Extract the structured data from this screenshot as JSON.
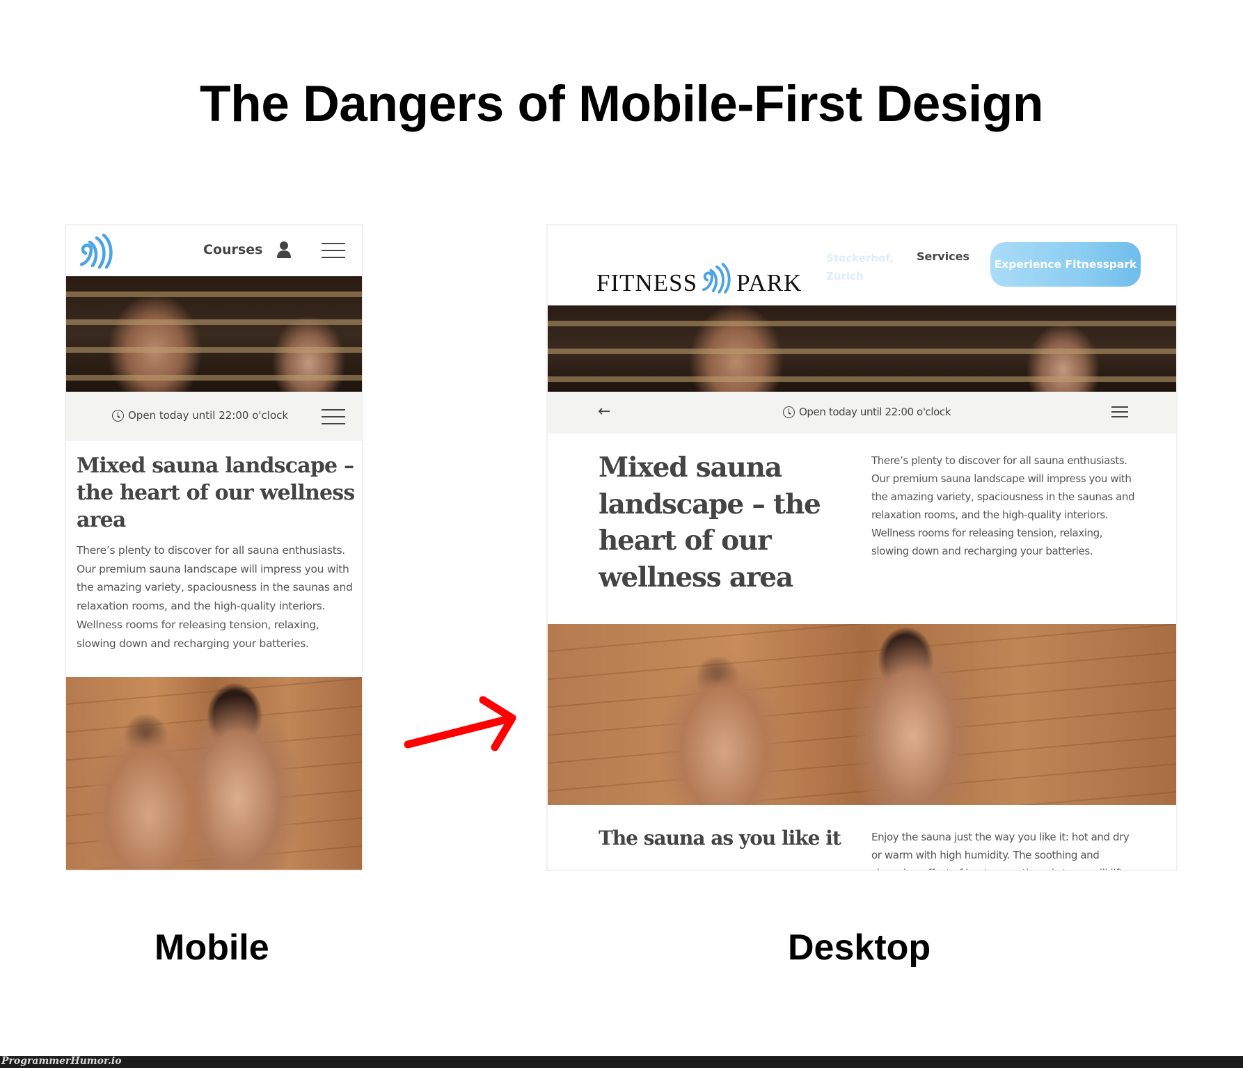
{
  "meme": {
    "title": "The Dangers of Mobile-First Design",
    "caption_mobile": "Mobile",
    "caption_desktop": "Desktop",
    "arrow_color": "#ff0000",
    "watermark": "ProgrammerHumor.io"
  },
  "brand": {
    "accent": "#4aa3e2",
    "cta_gradient": [
      "#aadcf8",
      "#6fbdeb"
    ],
    "text_color": "#444444",
    "infobar_bg": "#f3f3f2"
  },
  "mobile": {
    "logo_icon": "wave-logo-icon",
    "nav_courses": "Courses",
    "user_icon": "user-icon",
    "menu_icon": "hamburger-menu-icon",
    "hero_image": "sauna-hero-photo",
    "open_hours": "Open today until 22:00 o'clock",
    "heading": "Mixed sauna landscape – the heart of our wellness area",
    "body": "There’s plenty to discover for all sauna enthusiasts. Our premium sauna landscape will impress you with the amazing variety, spaciousness in the saunas and relaxation rooms, and the high-quality interiors. Wellness rooms for releasing tension, relaxing, slowing down and recharging your batteries.",
    "second_image": "sauna-couple-photo"
  },
  "desktop": {
    "logo_left": "FITNESS",
    "logo_right": "PARK",
    "location_line1": "Stockerhof,",
    "location_line2": "Zürich",
    "nav_services": "Services",
    "cta_label": "Experience Fitnesspark",
    "back_icon": "←",
    "open_hours": "Open today until 22:00 o'clock",
    "heading": "Mixed sauna landscape – the heart of our wellness area",
    "body": "There’s plenty to discover for all sauna enthusiasts. Our premium sauna landscape will impress you with the amazing variety, spaciousness in the saunas and relaxation rooms, and the high-quality interiors. Wellness rooms for releasing tension, relaxing, slowing down and recharging your batteries.",
    "section2_heading": "The sauna as you like it",
    "section2_body": "Enjoy the sauna just the way you like it: hot and dry or warm with high humidity. The soothing and cleansing effect of heat, warmth and steam will lift"
  }
}
